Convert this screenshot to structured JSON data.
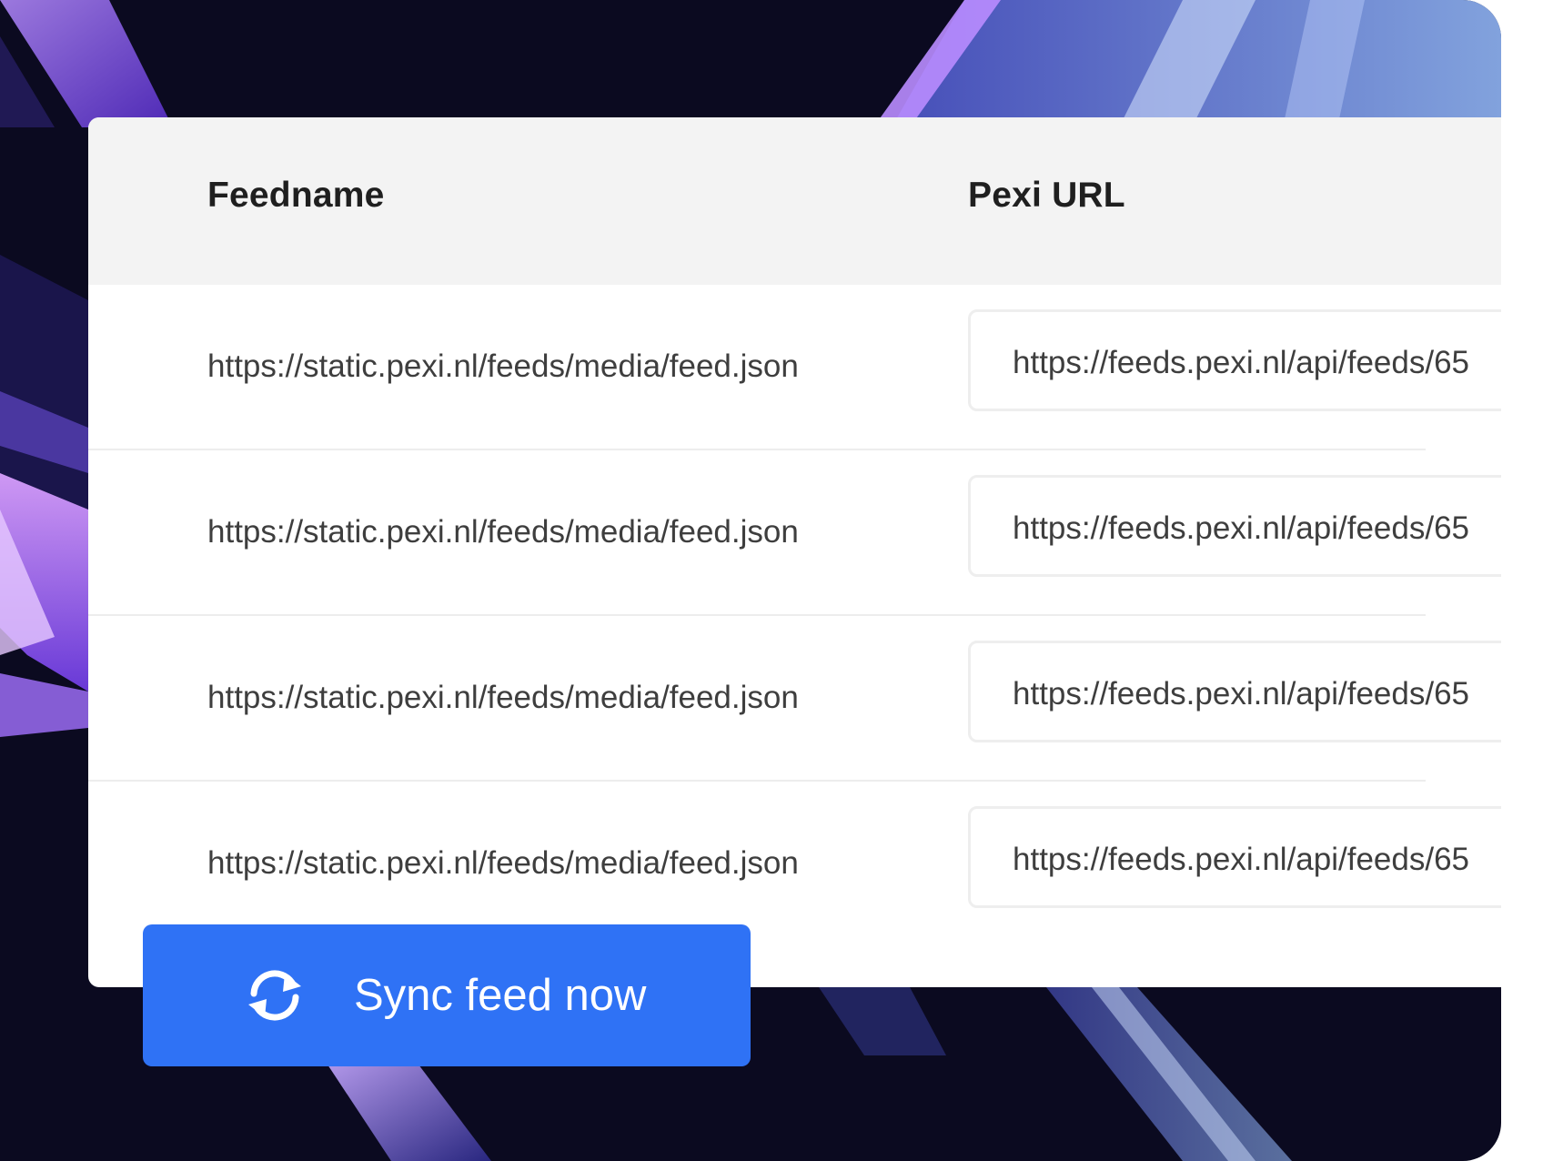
{
  "table": {
    "headers": {
      "feedname": "Feedname",
      "pexi_url": "Pexi URL"
    },
    "rows": [
      {
        "feedname": "https://static.pexi.nl/feeds/media/feed.json",
        "pexi_url": "https://feeds.pexi.nl/api/feeds/65"
      },
      {
        "feedname": "https://static.pexi.nl/feeds/media/feed.json",
        "pexi_url": "https://feeds.pexi.nl/api/feeds/65"
      },
      {
        "feedname": "https://static.pexi.nl/feeds/media/feed.json",
        "pexi_url": "https://feeds.pexi.nl/api/feeds/65"
      },
      {
        "feedname": "https://static.pexi.nl/feeds/media/feed.json",
        "pexi_url": "https://feeds.pexi.nl/api/feeds/65"
      }
    ]
  },
  "sync_button": {
    "label": "Sync feed now",
    "icon": "sync-icon"
  },
  "colors": {
    "button": "#2f72f5",
    "backdrop": "#0b0a20",
    "header_background": "#f3f3f3"
  }
}
